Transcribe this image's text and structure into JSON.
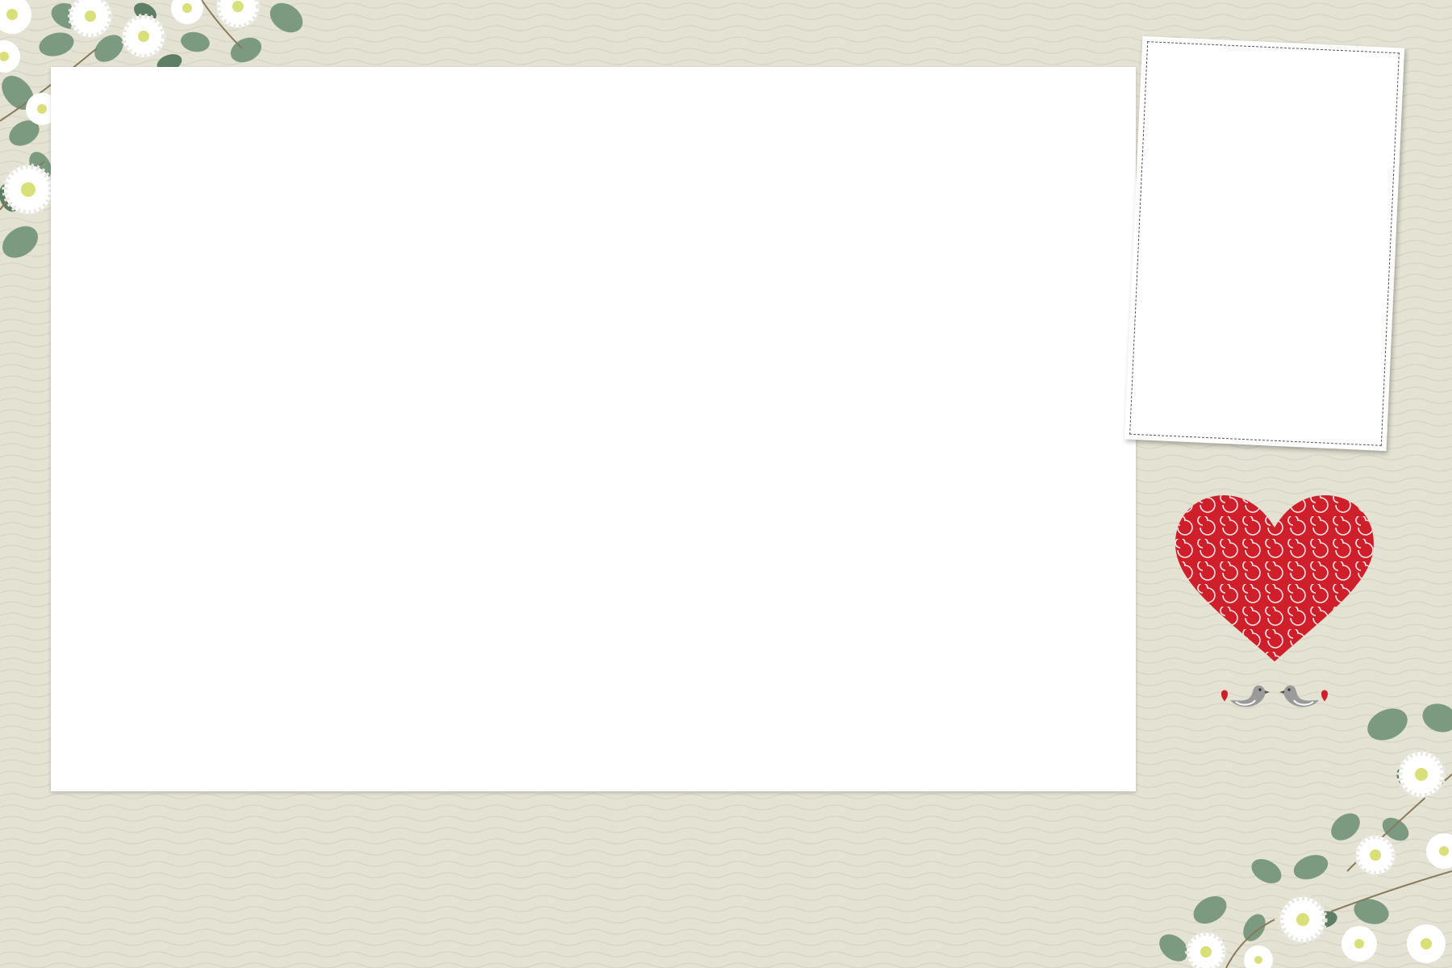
{
  "colors": {
    "background": "#e4e2d3",
    "wave_line": "#d8d6c6",
    "leaf": "#7a9a7e",
    "leaf_dark": "#5d7d63",
    "petal": "#ffffff",
    "flower_center": "#d7e07a",
    "heart": "#cf1f2a",
    "heart_swirl": "#ffffff",
    "bird": "#9a9a9a"
  },
  "decorations": {
    "top_left": "floral-corner",
    "bottom_right": "floral-corner",
    "heart": "swirl-heart-icon",
    "birds": "love-birds-icon"
  }
}
